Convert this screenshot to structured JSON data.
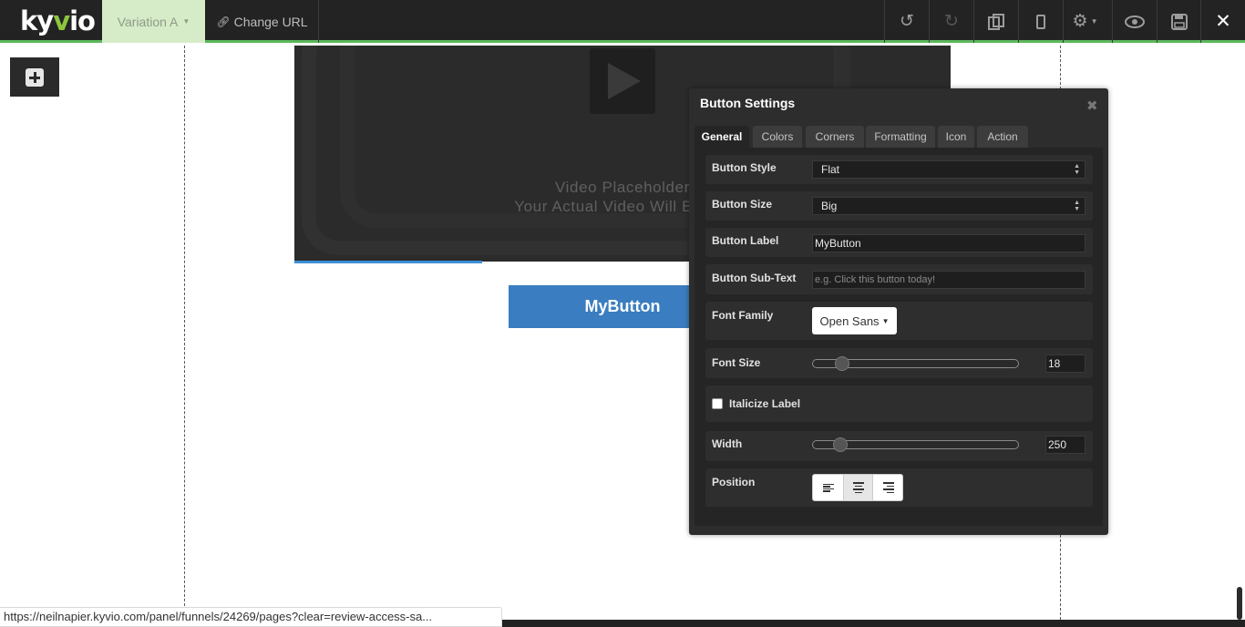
{
  "header": {
    "logo": {
      "left": "ky",
      "accent": "v",
      "right": "io"
    },
    "variation_label": "Variation A",
    "change_url_label": "Change URL",
    "tools": [
      "undo-icon",
      "redo-icon",
      "copy-icon",
      "mobile-icon",
      "settings-icon",
      "preview-icon",
      "save-icon",
      "close-icon"
    ],
    "accent_color": "#5cb85c"
  },
  "canvas": {
    "video_text_line1": "Video Placeholder",
    "video_text_line2": "Your Actual Video Will Be Dis",
    "button_label": "MyButton",
    "button_color": "#3a7dc0"
  },
  "panel": {
    "title": "Button Settings",
    "close_glyph": "✖",
    "tabs": [
      "General",
      "Colors",
      "Corners",
      "Formatting",
      "Icon",
      "Action"
    ],
    "active_tab": "General",
    "fields": {
      "button_style": {
        "label": "Button Style",
        "value": "Flat"
      },
      "button_size": {
        "label": "Button Size",
        "value": "Big"
      },
      "button_label": {
        "label": "Button Label",
        "value": "MyButton"
      },
      "button_subtext": {
        "label": "Button Sub-Text",
        "placeholder": "e.g. Click this button today!"
      },
      "font_family": {
        "label": "Font Family",
        "value": "Open Sans"
      },
      "font_size": {
        "label": "Font Size",
        "value": "18"
      },
      "italicize": {
        "label": "Italicize Label",
        "checked": false
      },
      "width": {
        "label": "Width",
        "value": "250"
      },
      "position": {
        "label": "Position",
        "options": [
          "left",
          "center",
          "right"
        ],
        "selected": "center"
      }
    }
  },
  "status_bar": {
    "url": "https://neilnapier.kyvio.com/panel/funnels/24269/pages?clear=review-access-sa..."
  }
}
